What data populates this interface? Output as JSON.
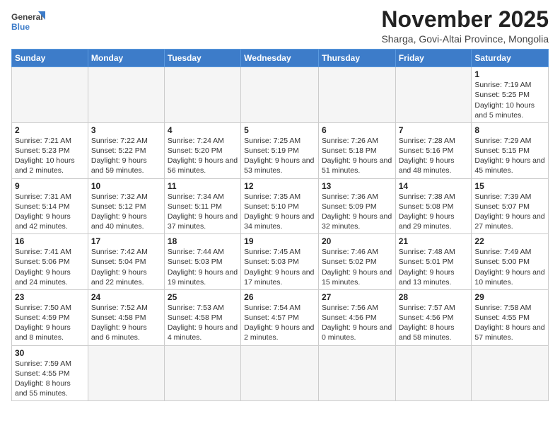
{
  "header": {
    "logo_general": "General",
    "logo_blue": "Blue",
    "month_title": "November 2025",
    "subtitle": "Sharga, Govi-Altai Province, Mongolia"
  },
  "weekdays": [
    "Sunday",
    "Monday",
    "Tuesday",
    "Wednesday",
    "Thursday",
    "Friday",
    "Saturday"
  ],
  "weeks": [
    [
      {
        "day": "",
        "info": ""
      },
      {
        "day": "",
        "info": ""
      },
      {
        "day": "",
        "info": ""
      },
      {
        "day": "",
        "info": ""
      },
      {
        "day": "",
        "info": ""
      },
      {
        "day": "",
        "info": ""
      },
      {
        "day": "1",
        "info": "Sunrise: 7:19 AM\nSunset: 5:25 PM\nDaylight: 10 hours and 5 minutes."
      }
    ],
    [
      {
        "day": "2",
        "info": "Sunrise: 7:21 AM\nSunset: 5:23 PM\nDaylight: 10 hours and 2 minutes."
      },
      {
        "day": "3",
        "info": "Sunrise: 7:22 AM\nSunset: 5:22 PM\nDaylight: 9 hours and 59 minutes."
      },
      {
        "day": "4",
        "info": "Sunrise: 7:24 AM\nSunset: 5:20 PM\nDaylight: 9 hours and 56 minutes."
      },
      {
        "day": "5",
        "info": "Sunrise: 7:25 AM\nSunset: 5:19 PM\nDaylight: 9 hours and 53 minutes."
      },
      {
        "day": "6",
        "info": "Sunrise: 7:26 AM\nSunset: 5:18 PM\nDaylight: 9 hours and 51 minutes."
      },
      {
        "day": "7",
        "info": "Sunrise: 7:28 AM\nSunset: 5:16 PM\nDaylight: 9 hours and 48 minutes."
      },
      {
        "day": "8",
        "info": "Sunrise: 7:29 AM\nSunset: 5:15 PM\nDaylight: 9 hours and 45 minutes."
      }
    ],
    [
      {
        "day": "9",
        "info": "Sunrise: 7:31 AM\nSunset: 5:14 PM\nDaylight: 9 hours and 42 minutes."
      },
      {
        "day": "10",
        "info": "Sunrise: 7:32 AM\nSunset: 5:12 PM\nDaylight: 9 hours and 40 minutes."
      },
      {
        "day": "11",
        "info": "Sunrise: 7:34 AM\nSunset: 5:11 PM\nDaylight: 9 hours and 37 minutes."
      },
      {
        "day": "12",
        "info": "Sunrise: 7:35 AM\nSunset: 5:10 PM\nDaylight: 9 hours and 34 minutes."
      },
      {
        "day": "13",
        "info": "Sunrise: 7:36 AM\nSunset: 5:09 PM\nDaylight: 9 hours and 32 minutes."
      },
      {
        "day": "14",
        "info": "Sunrise: 7:38 AM\nSunset: 5:08 PM\nDaylight: 9 hours and 29 minutes."
      },
      {
        "day": "15",
        "info": "Sunrise: 7:39 AM\nSunset: 5:07 PM\nDaylight: 9 hours and 27 minutes."
      }
    ],
    [
      {
        "day": "16",
        "info": "Sunrise: 7:41 AM\nSunset: 5:06 PM\nDaylight: 9 hours and 24 minutes."
      },
      {
        "day": "17",
        "info": "Sunrise: 7:42 AM\nSunset: 5:04 PM\nDaylight: 9 hours and 22 minutes."
      },
      {
        "day": "18",
        "info": "Sunrise: 7:44 AM\nSunset: 5:03 PM\nDaylight: 9 hours and 19 minutes."
      },
      {
        "day": "19",
        "info": "Sunrise: 7:45 AM\nSunset: 5:03 PM\nDaylight: 9 hours and 17 minutes."
      },
      {
        "day": "20",
        "info": "Sunrise: 7:46 AM\nSunset: 5:02 PM\nDaylight: 9 hours and 15 minutes."
      },
      {
        "day": "21",
        "info": "Sunrise: 7:48 AM\nSunset: 5:01 PM\nDaylight: 9 hours and 13 minutes."
      },
      {
        "day": "22",
        "info": "Sunrise: 7:49 AM\nSunset: 5:00 PM\nDaylight: 9 hours and 10 minutes."
      }
    ],
    [
      {
        "day": "23",
        "info": "Sunrise: 7:50 AM\nSunset: 4:59 PM\nDaylight: 9 hours and 8 minutes."
      },
      {
        "day": "24",
        "info": "Sunrise: 7:52 AM\nSunset: 4:58 PM\nDaylight: 9 hours and 6 minutes."
      },
      {
        "day": "25",
        "info": "Sunrise: 7:53 AM\nSunset: 4:58 PM\nDaylight: 9 hours and 4 minutes."
      },
      {
        "day": "26",
        "info": "Sunrise: 7:54 AM\nSunset: 4:57 PM\nDaylight: 9 hours and 2 minutes."
      },
      {
        "day": "27",
        "info": "Sunrise: 7:56 AM\nSunset: 4:56 PM\nDaylight: 9 hours and 0 minutes."
      },
      {
        "day": "28",
        "info": "Sunrise: 7:57 AM\nSunset: 4:56 PM\nDaylight: 8 hours and 58 minutes."
      },
      {
        "day": "29",
        "info": "Sunrise: 7:58 AM\nSunset: 4:55 PM\nDaylight: 8 hours and 57 minutes."
      }
    ],
    [
      {
        "day": "30",
        "info": "Sunrise: 7:59 AM\nSunset: 4:55 PM\nDaylight: 8 hours and 55 minutes."
      },
      {
        "day": "",
        "info": ""
      },
      {
        "day": "",
        "info": ""
      },
      {
        "day": "",
        "info": ""
      },
      {
        "day": "",
        "info": ""
      },
      {
        "day": "",
        "info": ""
      },
      {
        "day": "",
        "info": ""
      }
    ]
  ]
}
